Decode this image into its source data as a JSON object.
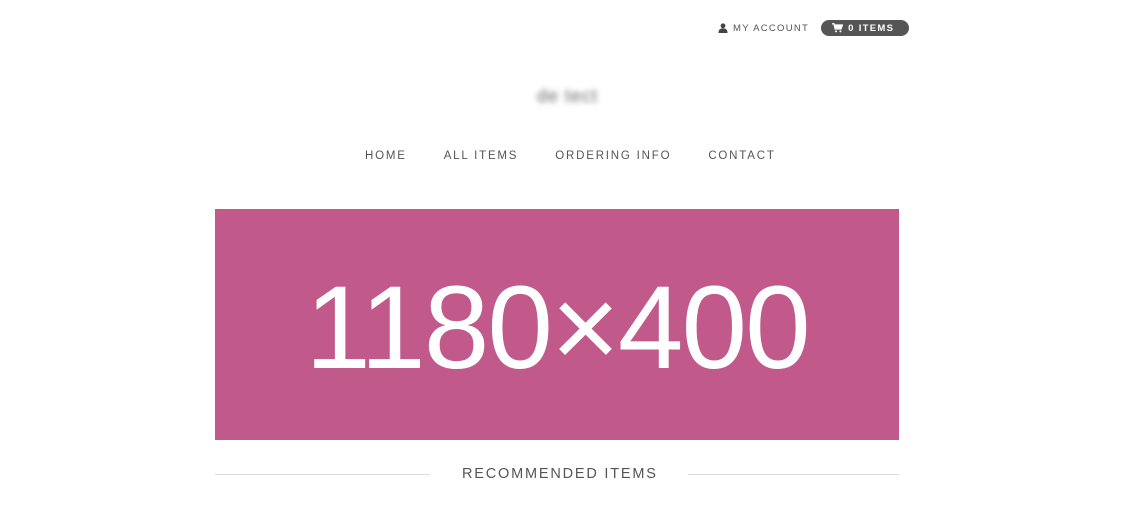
{
  "header": {
    "account_label": "MY ACCOUNT",
    "cart_label": "0 ITEMS",
    "logo_text": "de tect"
  },
  "nav": {
    "items": [
      {
        "label": "HOME"
      },
      {
        "label": "ALL ITEMS"
      },
      {
        "label": "ORDERING INFO"
      },
      {
        "label": "CONTACT"
      }
    ]
  },
  "hero": {
    "text": "1180×400",
    "background_color": "#c15a8a"
  },
  "sections": {
    "recommended_heading": "RECOMMENDED ITEMS"
  },
  "icons": {
    "account": "user-icon",
    "cart": "shopping-cart-icon"
  },
  "colors": {
    "cart_pill": "#555555",
    "text": "#555555",
    "divider": "#dcdcdc"
  }
}
